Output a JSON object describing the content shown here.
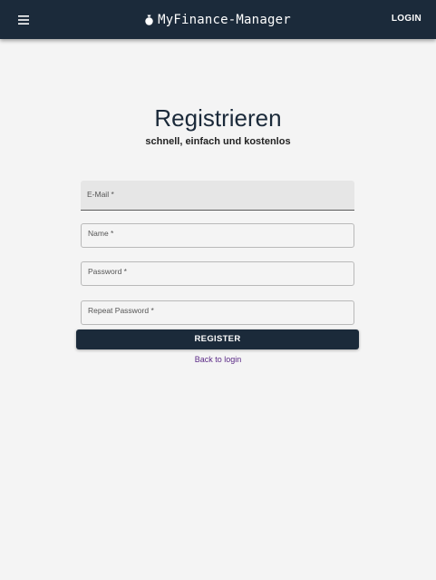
{
  "header": {
    "app_name": "MyFinance-Manager",
    "menu_icon": "hamburger-menu-icon",
    "logo_icon": "money-bag-icon",
    "login_label": "LOGIN",
    "background_color": "#1b2a3a"
  },
  "register": {
    "title": "Registrieren",
    "subtitle": "schnell, einfach und kostenlos",
    "fields": [
      {
        "label": "E-Mail  *",
        "value": ""
      },
      {
        "label": "Name  *",
        "value": ""
      },
      {
        "label": "Password  *",
        "value": ""
      },
      {
        "label": "Repeat Password  *",
        "value": ""
      }
    ],
    "submit_label": "REGISTER",
    "back_link": "Back to login",
    "link_color": "#5b2a86"
  }
}
